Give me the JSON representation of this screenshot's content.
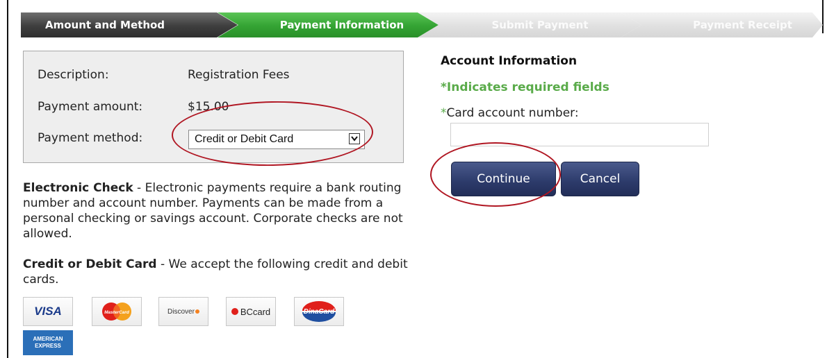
{
  "steps": [
    {
      "label": "Amount and Method",
      "state": "done"
    },
    {
      "label": "Payment Information",
      "state": "current"
    },
    {
      "label": "Submit Payment",
      "state": "pending"
    },
    {
      "label": "Payment Receipt",
      "state": "pending"
    }
  ],
  "summary": {
    "description_label": "Description:",
    "description_value": "Registration Fees",
    "amount_label": "Payment amount:",
    "amount_value": "$15.00",
    "method_label": "Payment method:",
    "method_selected": "Credit or Debit Card"
  },
  "info": {
    "echeck_title": "Electronic Check",
    "echeck_text": " - Electronic payments require a bank routing number and account number. Payments can be made from a personal checking or savings account. Corporate checks are not allowed.",
    "card_title": "Credit or Debit Card",
    "card_text": " - We accept the following credit and debit cards."
  },
  "cards": {
    "visa": "VISA",
    "mastercard": "MasterCard",
    "discover": "Discover",
    "bccard": "BCcard",
    "dinacard": "DinaCard",
    "amex_line1": "AMERICAN",
    "amex_line2": "EXPRESS"
  },
  "account": {
    "title": "Account Information",
    "required_note": "*Indicates required fields",
    "card_number_star": "*",
    "card_number_label": "Card account number:",
    "card_number_value": ""
  },
  "buttons": {
    "continue": "Continue",
    "cancel": "Cancel"
  },
  "colors": {
    "step_done": "#3e3e3e",
    "step_current": "#34a333",
    "step_pending": "#e0e0e0",
    "button": "#2c3a6a",
    "required": "#5aab4a",
    "highlight": "#b01622"
  }
}
